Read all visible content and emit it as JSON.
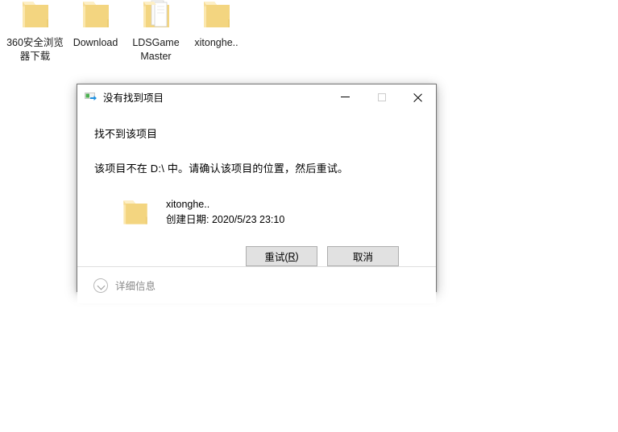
{
  "desktop": {
    "icons": [
      {
        "name": "360安全浏览器下载",
        "icon": "folder-icon",
        "type": "folder"
      },
      {
        "name": "Download",
        "icon": "folder-icon",
        "type": "folder"
      },
      {
        "name": "LDSGame Master",
        "icon": "folder-with-documents-icon",
        "type": "folder-documents"
      },
      {
        "name": "xitonghe..",
        "icon": "folder-icon",
        "type": "folder"
      }
    ]
  },
  "dialog": {
    "title": "没有找到项目",
    "title_icon": "move-item-icon",
    "window_controls": {
      "minimize": "最小化",
      "maximize": "最大化",
      "close": "关闭"
    },
    "heading": "找不到该项目",
    "message": "该项目不在 D:\\ 中。请确认该项目的位置，然后重试。",
    "item": {
      "icon": "folder-icon",
      "name": "xitonghe..",
      "date_label": "创建日期: 2020/5/23 23:10"
    },
    "buttons": {
      "retry": {
        "text": "重试(",
        "accel": "R",
        "text_end": ")"
      },
      "cancel": "取消"
    },
    "footer": {
      "details_label": "详细信息",
      "chevron_icon": "chevron-down-circle-icon"
    }
  },
  "colors": {
    "folder_front": "#f5d887",
    "folder_back": "#fae5aa",
    "dialog_border": "#767676",
    "button_face": "#e1e1e1",
    "button_border": "#adadad",
    "accent_blue": "#1e90e0",
    "accent_green": "#4cb050",
    "muted_text": "#8a8a8a"
  }
}
